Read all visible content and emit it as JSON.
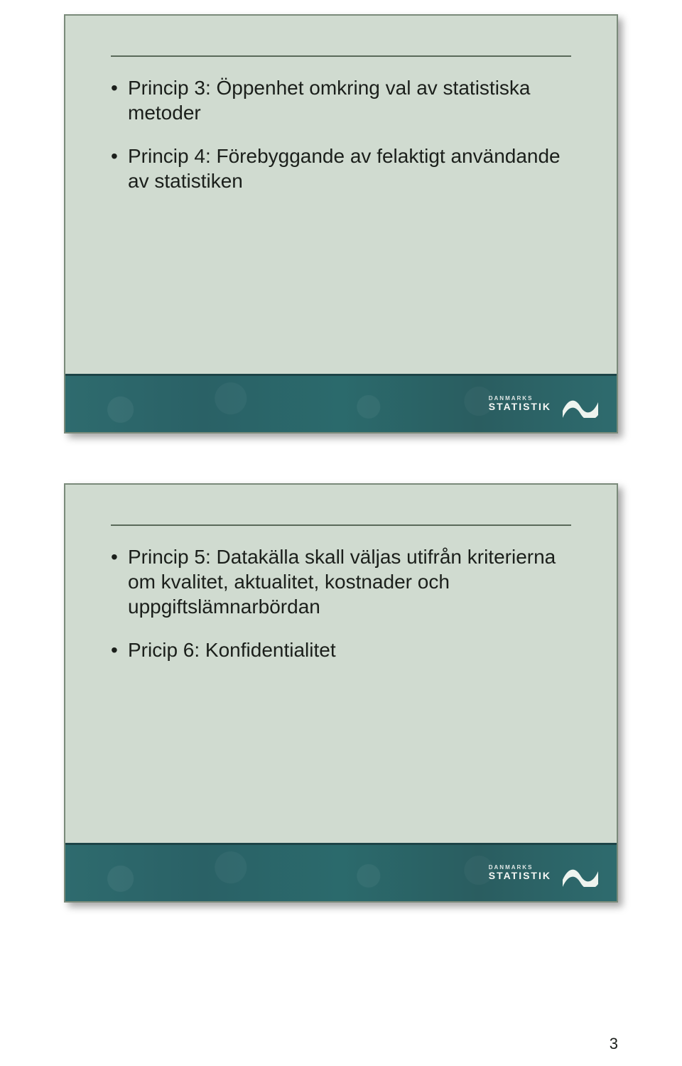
{
  "slides": [
    {
      "items": [
        "Princip 3: Öppenhet omkring val av statistiska metoder",
        "Princip 4: Förebyggande av felaktigt användande av statistiken"
      ]
    },
    {
      "items": [
        "Princip 5: Datakälla skall väljas utifrån kriterierna om kvalitet, aktualitet, kostnader och uppgiftslämnarbördan",
        "Pricip 6: Konfidentialitet"
      ]
    }
  ],
  "logo": {
    "line1": "DANMARKS",
    "line2": "STATISTIK"
  },
  "page_number": "3"
}
